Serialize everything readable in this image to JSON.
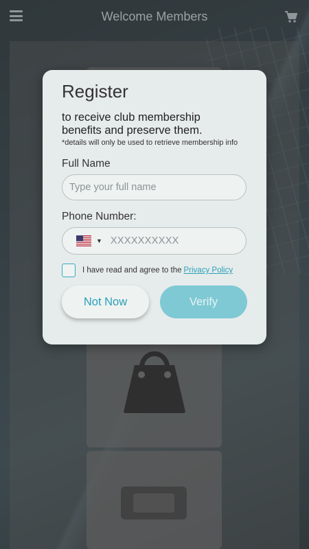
{
  "header": {
    "title": "Welcome Members",
    "menu_icon": "hamburger-menu-icon",
    "cart_icon": "shopping-cart-icon"
  },
  "background_cards": {
    "card_icons": [
      "shopping-bag-icon",
      "device-icon"
    ]
  },
  "modal": {
    "title": "Register",
    "subtitle": "to receive club membership benefits and preserve them.",
    "note": "*details will only be used to retrieve membership info",
    "full_name": {
      "label": "Full Name",
      "placeholder": "Type your full name",
      "value": ""
    },
    "phone": {
      "label": "Phone Number:",
      "country_flag": "us-flag-icon",
      "placeholder": "XXXXXXXXXX",
      "value": ""
    },
    "agreement": {
      "checked": false,
      "text": "I have read and agree to the",
      "link_text": "Privacy Policy"
    },
    "buttons": {
      "not_now": "Not Now",
      "verify": "Verify"
    }
  },
  "colors": {
    "accent": "#2a9fb8",
    "verify_button": "#7ec9d4",
    "modal_bg": "#e6eceb"
  }
}
